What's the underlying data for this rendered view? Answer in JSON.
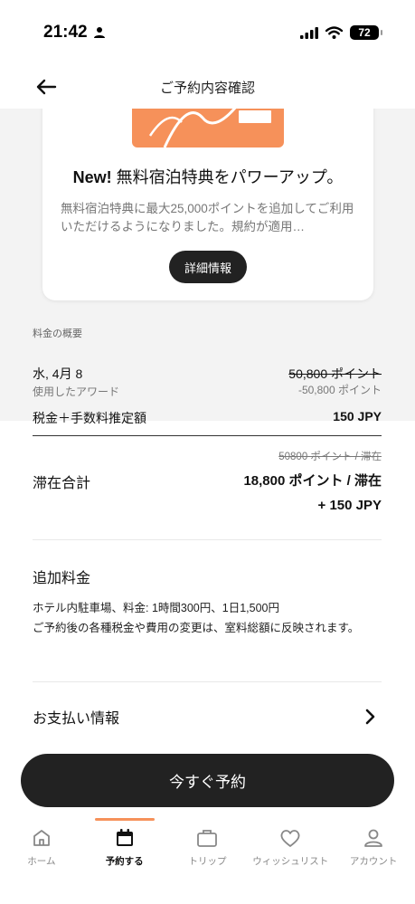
{
  "status_bar": {
    "time": "21:42",
    "battery": "72",
    "icons": [
      "person-icon",
      "signal-icon",
      "wifi-icon",
      "battery-icon"
    ]
  },
  "header": {
    "title": "ご予約内容確認",
    "back_icon": "arrow-left-icon"
  },
  "promo": {
    "title_bold": "New!",
    "title_rest": " 無料宿泊特典をパワーアップ。",
    "description": "無料宿泊特典に最大25,000ポイントを追加してご利用いただけるようになりました。規約が適用…",
    "button": "詳細情報",
    "accent": "#f6915a"
  },
  "summary": {
    "label": "料金の概要",
    "date": "水, 4月 8",
    "award_label": "使用したアワード",
    "original_points": "50,800 ポイント",
    "points_deduction": "-50,800 ポイント",
    "tax_label": "税金＋手数料推定額",
    "tax_value": "150 JPY",
    "total_strike": "50800 ポイント / 滞在",
    "total_label": "滞在合計",
    "total_points": "18,800 ポイント / 滞在",
    "total_cash": "+ 150 JPY"
  },
  "extra": {
    "title": "追加料金",
    "parking": "ホテル内駐車場、料金: 1時間300円、1日1,500円",
    "note": "ご予約後の各種税金や費用の変更は、室料総額に反映されます。"
  },
  "payment": {
    "label": "お支払い情報",
    "icon": "chevron-right-icon"
  },
  "cta": {
    "label": "今すぐ予約"
  },
  "tabs": [
    {
      "label": "ホーム",
      "icon": "home-icon",
      "active": false
    },
    {
      "label": "予約する",
      "icon": "calendar-icon",
      "active": true
    },
    {
      "label": "トリップ",
      "icon": "suitcase-icon",
      "active": false
    },
    {
      "label": "ウィッシュリスト",
      "icon": "heart-icon",
      "active": false
    },
    {
      "label": "アカウント",
      "icon": "person-icon",
      "active": false
    }
  ]
}
